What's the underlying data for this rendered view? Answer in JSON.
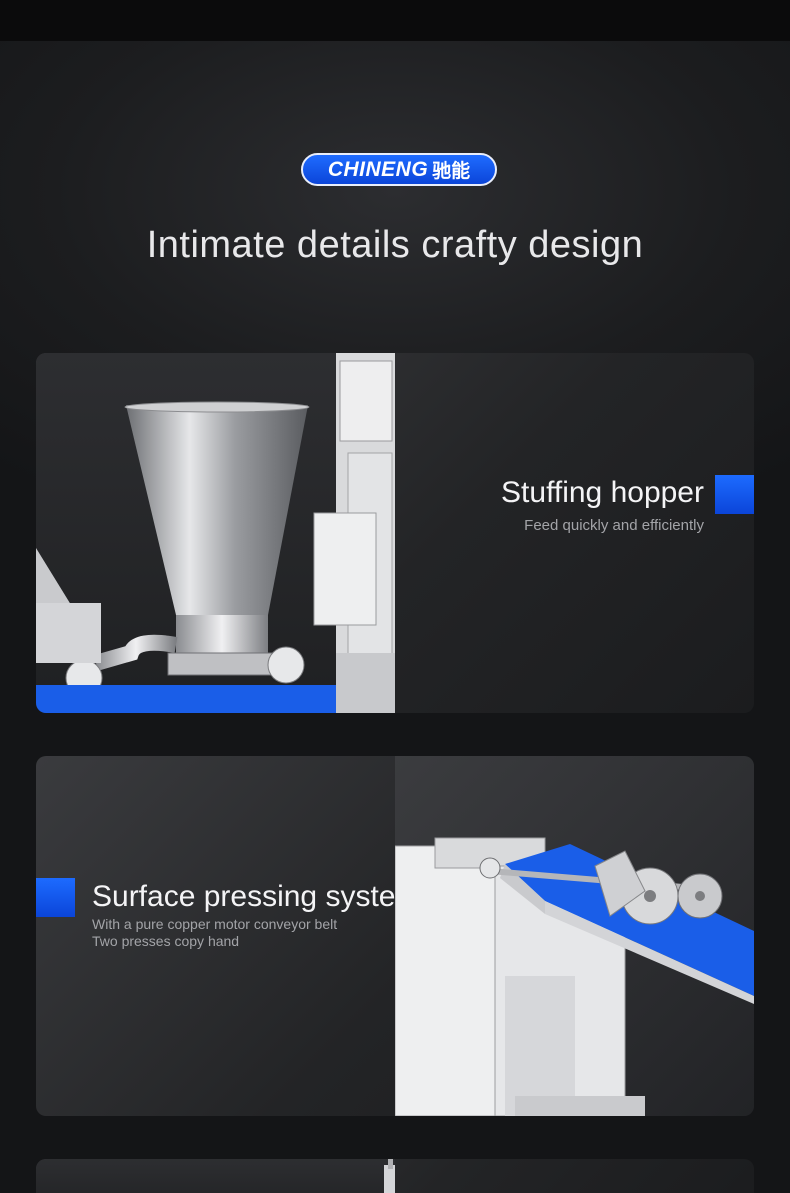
{
  "brand": {
    "latin": "CHINENG",
    "chinese": "驰能",
    "color": "#1f6cff"
  },
  "headline": "Intimate details crafty design",
  "features": [
    {
      "title": "Stuffing hopper",
      "subtitle": "Feed quickly and efficiently",
      "image": "stainless-steel-hopper-icon"
    },
    {
      "title": "Surface pressing system",
      "subtitle_lines": [
        "With a pure copper motor conveyor belt",
        "Two presses copy hand"
      ],
      "image": "conveyor-belt-press-icon"
    }
  ],
  "colors": {
    "accent": "#1d6bff",
    "background": "#1c1d1f",
    "conveyor": "#1a5ee8"
  }
}
